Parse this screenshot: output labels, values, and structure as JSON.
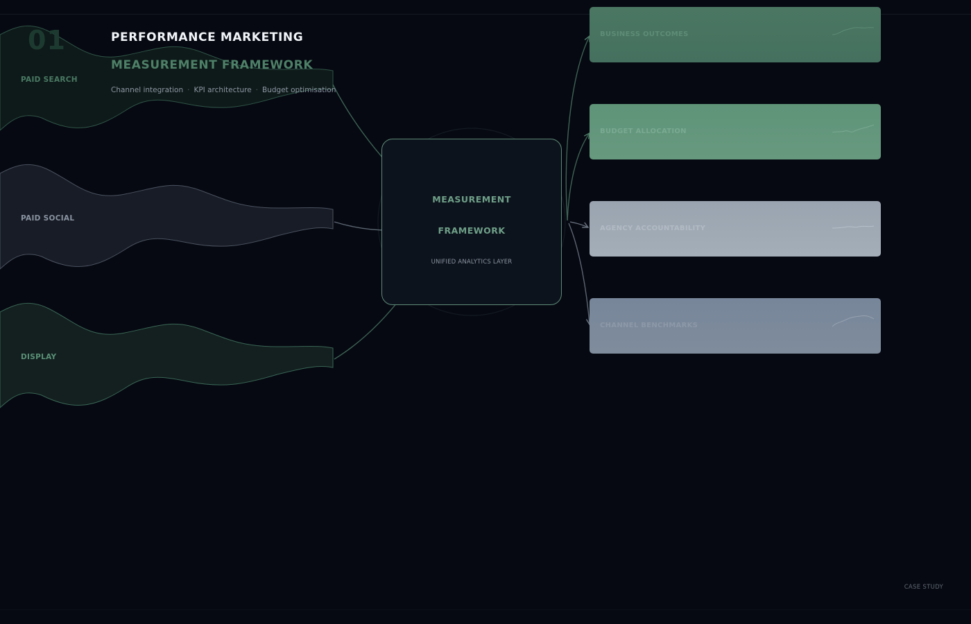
{
  "header": {
    "number": "01",
    "title_line1": "PERFORMANCE MARKETING",
    "title_line2": "MEASUREMENT FRAMEWORK",
    "subtitle_items": [
      "Channel integration",
      "KPI architecture",
      "Budget optimisation"
    ],
    "subtitle_separator": "·"
  },
  "channels": [
    {
      "label": "PAID SEARCH",
      "fill": "#0e1a19",
      "stroke": "#2f5448",
      "label_color": "#4a7a64"
    },
    {
      "label": "PAID SOCIAL",
      "fill": "#181c26",
      "stroke": "#4a5260",
      "label_color": "#8a94a2"
    },
    {
      "label": "DISPLAY",
      "fill": "#13201f",
      "stroke": "#3a6656",
      "label_color": "#5a9077"
    }
  ],
  "hub": {
    "title_line1": "MEASUREMENT",
    "title_line2": "FRAMEWORK",
    "subtitle": "UNIFIED ANALYTICS LAYER"
  },
  "outcomes": [
    {
      "label": "BUSINESS OUTCOMES",
      "color": "#4a7762",
      "color2": "#45705f",
      "label_color": "#5e8c76"
    },
    {
      "label": "BUDGET ALLOCATION",
      "color": "#5f9479",
      "color2": "#67997f",
      "label_color": "#7aaa92"
    },
    {
      "label": "AGENCY ACCOUNTABILITY",
      "color": "#9aa4b0",
      "color2": "#a4aeb8",
      "label_color": "#b2bbc4"
    },
    {
      "label": "CHANNEL BENCHMARKS",
      "color": "#77869a",
      "color2": "#7f8c9c",
      "label_color": "#8d99a8"
    }
  ],
  "footer": {
    "label": "CASE STUDY"
  }
}
